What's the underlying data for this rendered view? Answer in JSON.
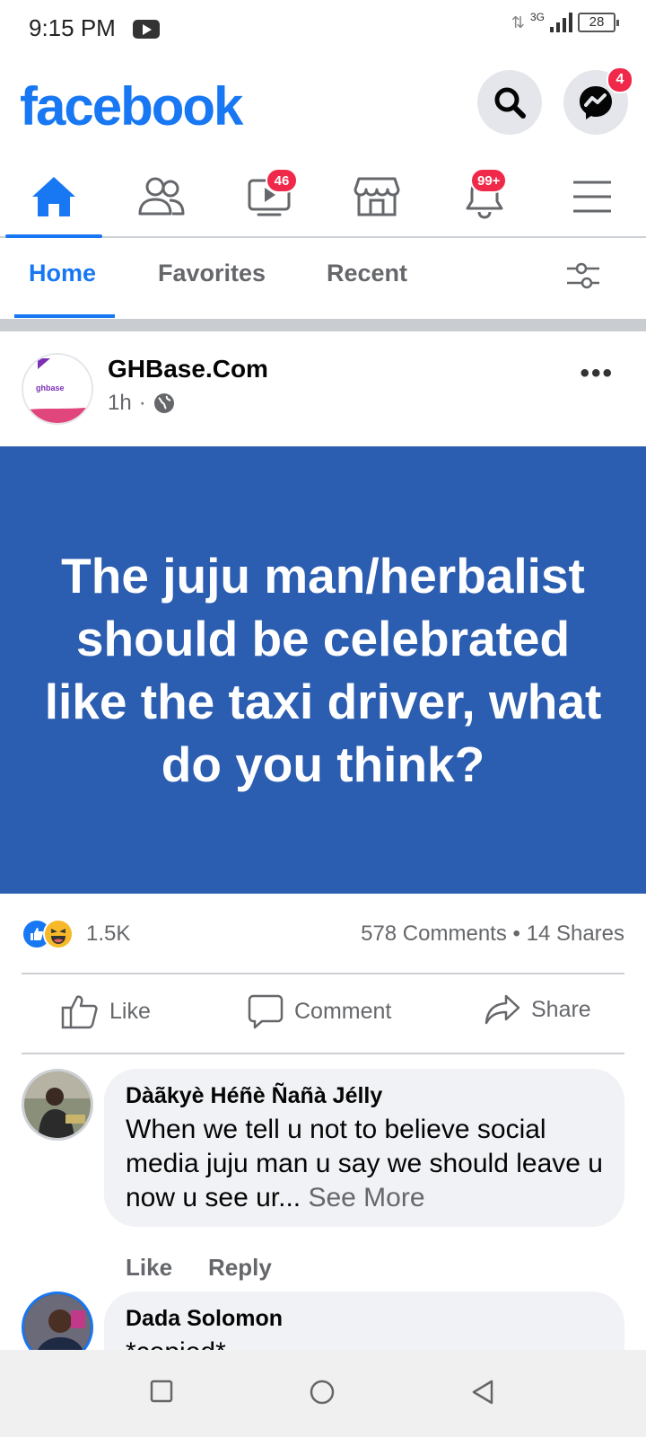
{
  "status_bar": {
    "time": "9:15 PM",
    "network": "3G",
    "battery": "28"
  },
  "header": {
    "logo": "facebook",
    "messenger_badge": "4"
  },
  "nav": {
    "items": [
      {
        "name": "home",
        "badge": ""
      },
      {
        "name": "friends",
        "badge": ""
      },
      {
        "name": "watch",
        "badge": "46"
      },
      {
        "name": "marketplace",
        "badge": ""
      },
      {
        "name": "notifications",
        "badge": "99+"
      },
      {
        "name": "menu",
        "badge": ""
      }
    ]
  },
  "tabs": {
    "home": "Home",
    "favorites": "Favorites",
    "recent": "Recent"
  },
  "post": {
    "author": "GHBase.Com",
    "time": "1h",
    "separator": "·",
    "avatar_text": "ghbase",
    "text": "The juju man/herbalist should be celebrated like the taxi driver, what do you think?",
    "background_color": "#2b5db0",
    "reaction_count": "1.5K",
    "comments": "578 Comments",
    "shares": "14 Shares",
    "stats_separator": "•"
  },
  "actions": {
    "like": "Like",
    "comment": "Comment",
    "share": "Share"
  },
  "comments": [
    {
      "name": "Dàãkyè Héñè  Ñañà Jélly",
      "text": "When we tell u not to believe  social media juju man u say we should leave u  now u see ur...",
      "see_more": "See More",
      "like": "Like",
      "reply": "Reply"
    },
    {
      "name": "Dada Solomon",
      "text": "*copied*"
    }
  ]
}
